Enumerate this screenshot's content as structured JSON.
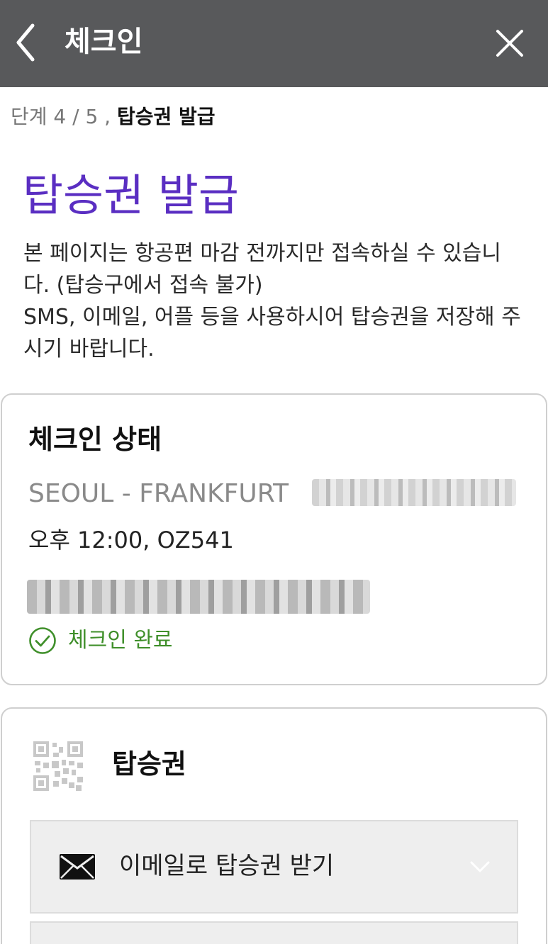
{
  "header": {
    "title": "체크인",
    "back_icon": "chevron-left-icon",
    "close_icon": "close-icon",
    "background_color": "#58595b"
  },
  "step": {
    "prefix": "단계 4 / 5 ,",
    "current": "탑승권 발급"
  },
  "page": {
    "title": "탑승권 발급",
    "title_color": "#5a2ec2",
    "notice_line1": "본 페이지는 항공편 마감 전까지만 접속하실 수 있습니다. (탑승구에서 접속 불가)",
    "notice_line2": "SMS, 이메일, 어플 등을 사용하시어 탑승권을 저장해 주시기 바랍니다."
  },
  "checkin_status": {
    "heading": "체크인 상태",
    "route": "SEOUL - FRANKFURT",
    "flight": "오후 12:00, OZ541",
    "status_text": "체크인 완료",
    "status_icon": "check-circle-icon",
    "status_color": "#3f8f2a"
  },
  "boarding_pass": {
    "heading": "탑승권",
    "icon": "qr-code-icon",
    "options": [
      {
        "label": "이메일로 탑승권 받기",
        "icon": "envelope-icon",
        "expand_icon": "chevron-down-icon"
      }
    ]
  }
}
